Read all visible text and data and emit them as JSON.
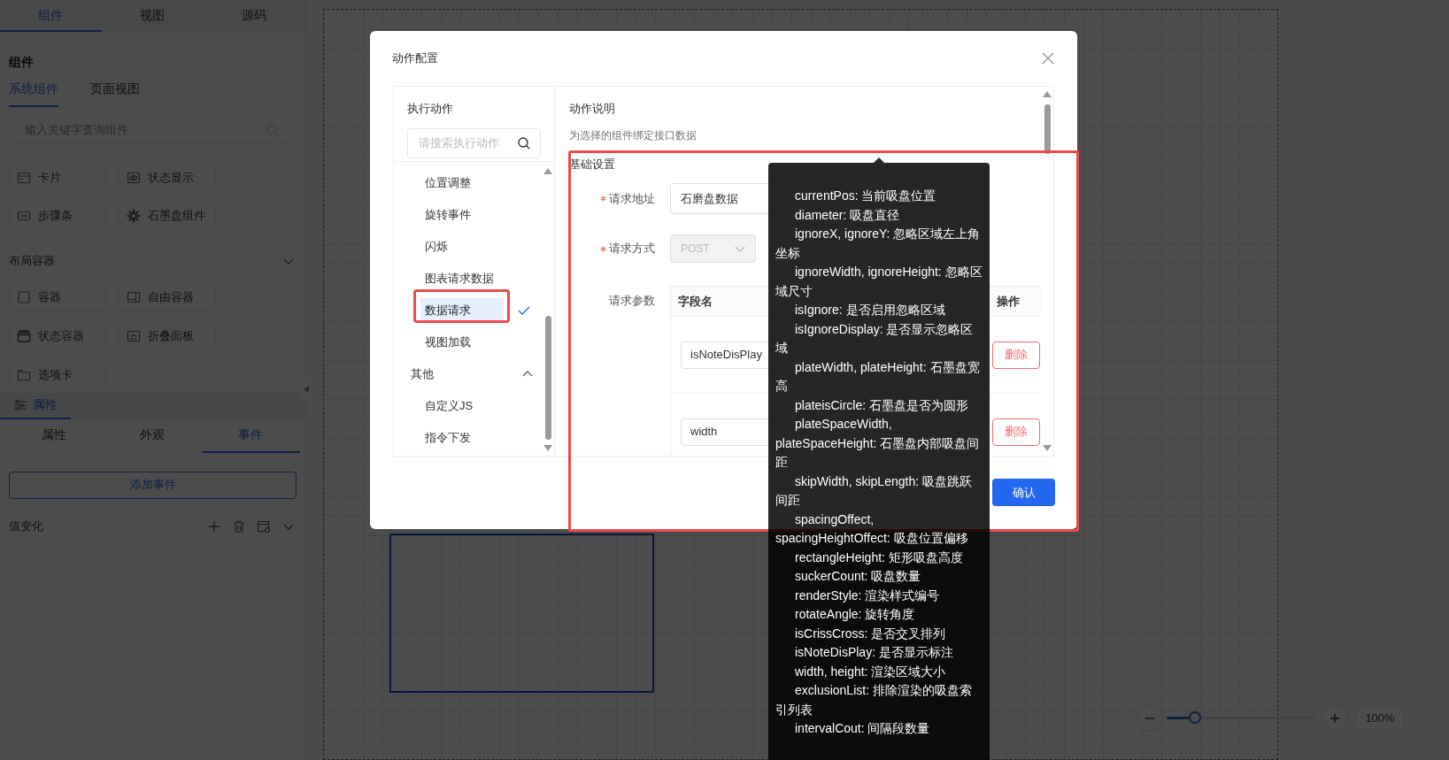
{
  "left_panel": {
    "tabs": [
      {
        "label": "组件",
        "selected": true
      },
      {
        "label": "视图",
        "selected": false
      },
      {
        "label": "源码",
        "selected": false
      }
    ],
    "title": "组件",
    "sub_tabs": [
      {
        "label": "系统组件",
        "selected": true
      },
      {
        "label": "页面视图",
        "selected": false
      }
    ],
    "search": {
      "placeholder": "输入关键字查询组件"
    },
    "system_components": [
      "卡片",
      "状态显示",
      "步骤条",
      "石墨盘组件"
    ],
    "layout_section": {
      "title": "布局容器",
      "expanded": true
    },
    "layout_components": [
      "容器",
      "自由容器",
      "状态容器",
      "折叠面板",
      "选项卡"
    ],
    "panel_tab": {
      "label": "属性",
      "selected": true
    },
    "property_tabs": [
      {
        "label": "属性",
        "selected": false
      },
      {
        "label": "外观",
        "selected": false
      },
      {
        "label": "事件",
        "selected": true
      }
    ],
    "add_event_button": "添加事件",
    "event": {
      "label": "值变化"
    }
  },
  "canvas": {
    "zoom": {
      "level": 0.19,
      "reading": "100%"
    }
  },
  "dialog": {
    "title": "动作配置",
    "action_panel": {
      "title": "执行动作",
      "search": {
        "placeholder": "请搜索执行动作"
      },
      "items": [
        {
          "kind": "item",
          "label": "位置调整",
          "selected": false
        },
        {
          "kind": "item",
          "label": "旋转事件",
          "selected": false
        },
        {
          "kind": "item",
          "label": "闪烁",
          "selected": false
        },
        {
          "kind": "item",
          "label": "图表请求数据",
          "selected": false
        },
        {
          "kind": "item",
          "label": "数据请求",
          "selected": true
        },
        {
          "kind": "item",
          "label": "视图加载",
          "selected": false
        },
        {
          "kind": "group",
          "label": "其他",
          "expanded": true,
          "children": [
            {
              "kind": "item",
              "label": "自定义JS",
              "selected": false
            },
            {
              "kind": "item",
              "label": "指令下发",
              "selected": false
            }
          ]
        }
      ]
    },
    "description_title": "动作说明",
    "description": "为选择的组件绑定接口数据",
    "settings_title": "基础设置",
    "form": [
      {
        "kind": "input",
        "label": "请求地址",
        "required": true,
        "value": "石磨盘数据"
      },
      {
        "kind": "select",
        "label": "请求方式",
        "required": true,
        "value": "POST",
        "disabled": true
      },
      {
        "kind": "table",
        "label": "请求参数",
        "required": false
      }
    ],
    "params_table": {
      "columns": [
        "字段名",
        "操作"
      ],
      "rows": [
        {
          "field": "isNoteDisPlay",
          "action": "删除"
        },
        {
          "field": "width",
          "action": "删除"
        }
      ]
    },
    "confirm_button": "确认"
  },
  "tooltip": {
    "entries": [
      "currentPos: 当前吸盘位置",
      "diameter: 吸盘直径",
      "ignoreX, ignoreY: 忽略区域左上角坐标",
      "ignoreWidth, ignoreHeight: 忽略区域尺寸",
      "isIgnore: 是否启用忽略区域",
      "isIgnoreDisplay: 是否显示忽略区域",
      "plateWidth, plateHeight: 石墨盘宽高",
      "plateisCircle: 石墨盘是否为圆形",
      "plateSpaceWidth, plateSpaceHeight: 石墨盘内部吸盘间距",
      "skipWidth, skipLength: 吸盘跳跃间距",
      "spacingOffect, spacingHeightOffect: 吸盘位置偏移",
      "rectangleHeight: 矩形吸盘高度",
      "suckerCount: 吸盘数量",
      "renderStyle: 渲染样式编号",
      "rotateAngle: 旋转角度",
      "isCrissCross: 是否交叉排列",
      "isNoteDisPlay: 是否显示标注",
      "width, height: 渲染区域大小",
      "exclusionList: 排除渲染的吸盘索引列表",
      "intervalCout: 间隔段数量"
    ]
  }
}
